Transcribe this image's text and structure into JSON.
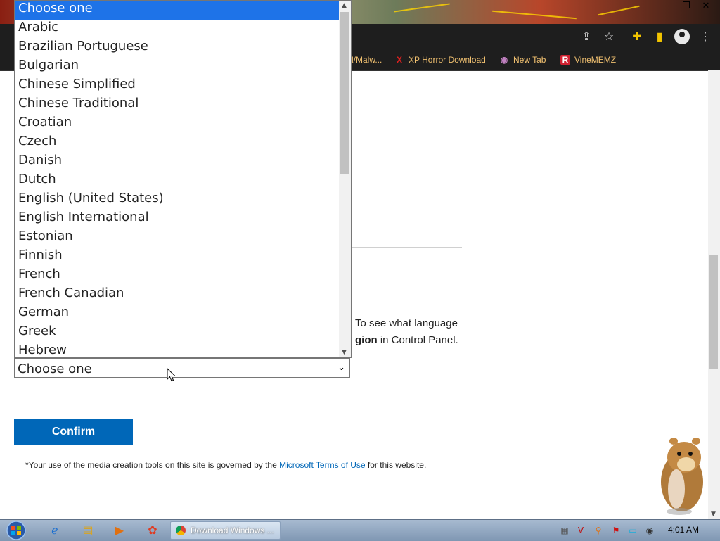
{
  "browser": {
    "window_controls": [
      "—",
      "❐",
      "✕"
    ],
    "toolbar_icons": [
      "share-icon",
      "star-icon",
      "extensions-icon",
      "sidebar-icon",
      "profile-icon",
      "menu-icon"
    ],
    "bookmarks": [
      {
        "label": "l/Malw...",
        "icon": ""
      },
      {
        "label": "XP Horror Download",
        "icon": "X"
      },
      {
        "label": "New Tab",
        "icon": "◉"
      },
      {
        "label": "VineMEMZ",
        "icon": "R"
      }
    ]
  },
  "page": {
    "lang_note_line1": "To see what language",
    "lang_note_bold": "gion",
    "lang_note_rest": " in Control Panel.",
    "select": {
      "value": "Choose one",
      "options": [
        "Choose one",
        "Arabic",
        "Brazilian Portuguese",
        "Bulgarian",
        "Chinese Simplified",
        "Chinese Traditional",
        "Croatian",
        "Czech",
        "Danish",
        "Dutch",
        "English (United States)",
        "English International",
        "Estonian",
        "Finnish",
        "French",
        "French Canadian",
        "German",
        "Greek",
        "Hebrew"
      ],
      "selected_index": 0
    },
    "confirm_label": "Confirm",
    "terms_prefix": "*Your use of the media creation tools on this site is governed by the ",
    "terms_link": "Microsoft Terms of Use",
    "terms_suffix": " for this website."
  },
  "taskbar": {
    "active_task": "Download Windows ...",
    "clock": "4:01 AM"
  },
  "colors": {
    "accent": "#0067b8",
    "selected_option": "#1e73e8"
  }
}
